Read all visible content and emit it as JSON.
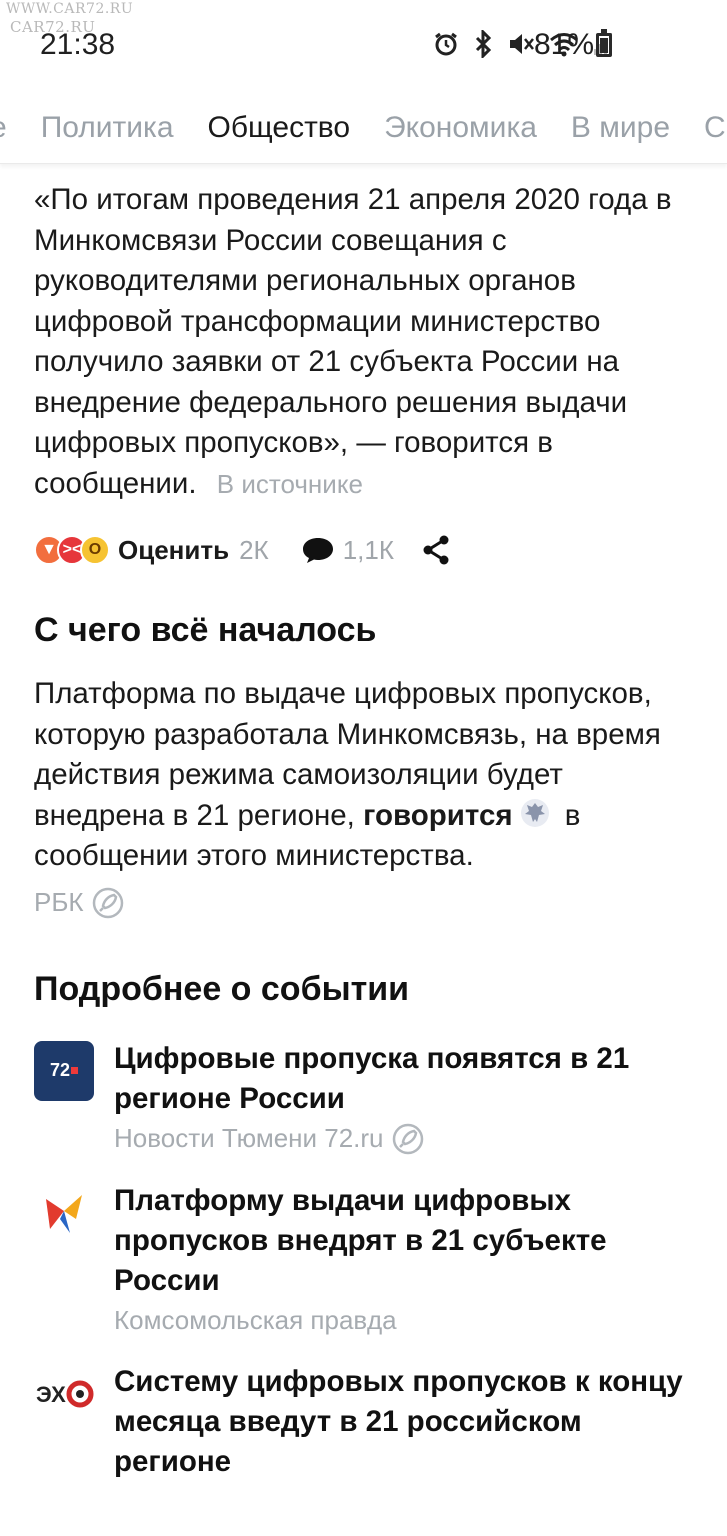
{
  "watermark": {
    "line1": "WWW.CAR72.RU",
    "line2": "CAR72.RU"
  },
  "status_bar": {
    "time": "21:38",
    "battery_percent": "81%",
    "battery_level": 0.81,
    "icons": [
      "alarm-icon",
      "bluetooth-icon",
      "mute-icon",
      "wifi-icon",
      "signal-icon",
      "battery-icon"
    ]
  },
  "tabs": [
    {
      "label": "е",
      "active": false
    },
    {
      "label": "Политика",
      "active": false
    },
    {
      "label": "Общество",
      "active": true
    },
    {
      "label": "Экономика",
      "active": false
    },
    {
      "label": "В мире",
      "active": false
    },
    {
      "label": "С",
      "active": false
    }
  ],
  "article": {
    "quote": "«По итогам проведения 21 апреля 2020 года в Минкомсвязи России совещания с руководителями региональных органов цифровой трансформации министерство получило заявки от 21 субъекта России на внедрение федерального решения выдачи цифровых пропусков», — говорится в сообщении.",
    "source_link": "В источнике",
    "actions": {
      "rate_label": "Оценить",
      "rate_count": "2К",
      "comment_count": "1,1К"
    }
  },
  "section_origin": {
    "title": "С чего всё началось",
    "text_before": "Платформа по выдаче цифровых пропусков, которую разработала Минкомсвязь, на время действия режима самоизоляции будет внедрена в 21 регионе, ",
    "text_bold": "говорится",
    "text_after": " в сообщении этого министерства.",
    "source": "РБК"
  },
  "section_more": {
    "title": "Подробнее о событии",
    "items": [
      {
        "title": "Цифровые пропуска появятся в 21 регионе России",
        "source": "Новости Тюмени 72.ru",
        "logo": "72"
      },
      {
        "title": "Платформу выдачи цифровых пропусков внедрят в 21 субъекте России",
        "source": "Комсомольская правда",
        "logo": ""
      },
      {
        "title": "Систему цифровых пропусков к концу месяца введут в 21 российском регионе",
        "source": "",
        "logo": "ЭХО"
      }
    ]
  },
  "colors": {
    "muted_text": "#a6abb0",
    "tab_inactive": "#9aa1a8",
    "logo_72_bg": "#1e3a6a"
  }
}
